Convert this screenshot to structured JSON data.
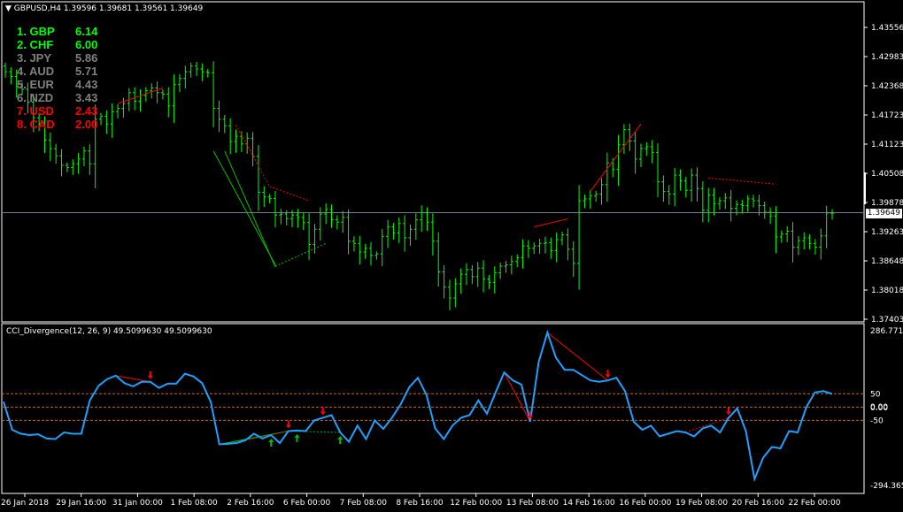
{
  "header": {
    "symbol_line": "GBPUSD,H4  1.39596 1.39681 1.39561 1.39649",
    "indicator_line": "CCI_Divergence(12, 26, 9) 49.5099630 49.5099630"
  },
  "price_tag": "1.39649",
  "strength_list": [
    {
      "label": "1. GBP",
      "value": "6.14",
      "color": "#00ff00"
    },
    {
      "label": "2. CHF",
      "value": "6.00",
      "color": "#00ff00"
    },
    {
      "label": "3. JPY",
      "value": "5.86",
      "color": "#808080"
    },
    {
      "label": "4. AUD",
      "value": "5.71",
      "color": "#808080"
    },
    {
      "label": "5. EUR",
      "value": "4.43",
      "color": "#808080"
    },
    {
      "label": "6. NZD",
      "value": "3.43",
      "color": "#808080"
    },
    {
      "label": "7. USD",
      "value": "2.43",
      "color": "#ff0000"
    },
    {
      "label": "8. CAD",
      "value": "2.00",
      "color": "#ff0000"
    }
  ],
  "price_axis_ticks": [
    "1.43556",
    "1.42983",
    "1.42368",
    "1.41723",
    "1.41123",
    "1.40508",
    "1.39878",
    "1.39263",
    "1.38648",
    "1.38018",
    "1.37403"
  ],
  "indicator_axis_ticks": [
    "286.7715",
    "50",
    "0.00",
    "0.00",
    "-50",
    "-294.3655"
  ],
  "time_axis_ticks": [
    "26 Jan 2018",
    "29 Jan 16:00",
    "31 Jan 00:00",
    "1 Feb 08:00",
    "2 Feb 16:00",
    "6 Feb 00:00",
    "7 Feb 08:00",
    "8 Feb 16:00",
    "12 Feb 00:00",
    "13 Feb 08:00",
    "14 Feb 16:00",
    "16 Feb 00:00",
    "19 Feb 08:00",
    "20 Feb 16:00",
    "22 Feb 00:00"
  ],
  "colors": {
    "background": "#000000",
    "frame": "#ffffff",
    "candles": "#00ff00",
    "cci_line": "#1ea0ff",
    "divergence_bear": "#ff0000",
    "divergence_bull": "#00c000",
    "level_lines": "#c86420",
    "price_line": "#708090"
  },
  "chart_data": [
    {
      "type": "bar",
      "title": "GBPUSD,H4",
      "ylim": [
        1.37403,
        1.43556
      ],
      "close_price": 1.39649,
      "closes": [
        1.4262,
        1.4252,
        1.4232,
        1.4225,
        1.4198,
        1.4165,
        1.4152,
        1.4118,
        1.41,
        1.4085,
        1.4065,
        1.406,
        1.4068,
        1.4078,
        1.4095,
        1.4068,
        1.4162,
        1.4168,
        1.4152,
        1.4178,
        1.4185,
        1.4195,
        1.4218,
        1.42,
        1.4212,
        1.4222,
        1.4228,
        1.4218,
        1.4215,
        1.419,
        1.4235,
        1.4248,
        1.4262,
        1.4274,
        1.4268,
        1.4262,
        1.426,
        1.4185,
        1.4162,
        1.4148,
        1.4115,
        1.4126,
        1.411,
        1.4122,
        1.4084,
        1.4008,
        1.3998,
        1.3995,
        1.396,
        1.3962,
        1.3952,
        1.396,
        1.3955,
        1.3944,
        1.3898,
        1.393,
        1.3962,
        1.3972,
        1.395,
        1.3945,
        1.3955,
        1.3905,
        1.39,
        1.3882,
        1.389,
        1.3875,
        1.3878,
        1.3915,
        1.3935,
        1.3922,
        1.3942,
        1.3912,
        1.393,
        1.395,
        1.3965,
        1.3945,
        1.3905,
        1.384,
        1.3808,
        1.3785,
        1.3815,
        1.3835,
        1.3845,
        1.383,
        1.3848,
        1.3825,
        1.3818,
        1.3838,
        1.3852,
        1.3855,
        1.3862,
        1.387,
        1.3895,
        1.389,
        1.3895,
        1.39,
        1.3902,
        1.3885,
        1.3908,
        1.3918,
        1.3888,
        1.3858,
        1.399,
        1.3994,
        1.4,
        1.4004,
        1.4024,
        1.407,
        1.4056,
        1.4108,
        1.414,
        1.4116,
        1.4078,
        1.41,
        1.4104,
        1.4092,
        1.403,
        1.401,
        1.4004,
        1.4044,
        1.4032,
        1.4012,
        1.4044,
        1.4016,
        1.397,
        1.4002,
        1.3984,
        1.399,
        1.3996,
        1.3974,
        1.3982,
        1.398,
        1.3994,
        1.399,
        1.398,
        1.3966,
        1.3958,
        1.3914,
        1.392,
        1.3926,
        1.3892,
        1.3906,
        1.3912,
        1.39,
        1.3892,
        1.3916,
        1.3964,
        1.3964
      ]
    },
    {
      "type": "line",
      "title": "CCI_Divergence(12, 26, 9)",
      "ylim": [
        -294.3655,
        286.7715
      ],
      "levels": [
        50,
        0,
        -50
      ],
      "last_value": 49.509963,
      "series": [
        {
          "values": [
            20,
            -85,
            -100,
            -105,
            -102,
            -118,
            -120,
            -95,
            -100,
            -100,
            25,
            80,
            105,
            118,
            90,
            78,
            95,
            95,
            72,
            88,
            88,
            125,
            115,
            90,
            20,
            -140,
            -138,
            -135,
            -125,
            -100,
            -118,
            -105,
            -135,
            -90,
            -88,
            -90,
            -50,
            -40,
            -30,
            -95,
            -130,
            -70,
            -120,
            -50,
            -82,
            -40,
            10,
            75,
            110,
            45,
            -80,
            -120,
            -70,
            -40,
            -30,
            25,
            -25,
            55,
            130,
            100,
            85,
            -55,
            170,
            280,
            185,
            140,
            140,
            120,
            100,
            95,
            100,
            110,
            60,
            -55,
            -85,
            -70,
            -110,
            -100,
            -90,
            -95,
            -110,
            -80,
            -70,
            -95,
            -40,
            -5,
            -90,
            -270,
            -190,
            -150,
            -155,
            -90,
            -95,
            0,
            55,
            60,
            49.5
          ]
        }
      ]
    }
  ]
}
